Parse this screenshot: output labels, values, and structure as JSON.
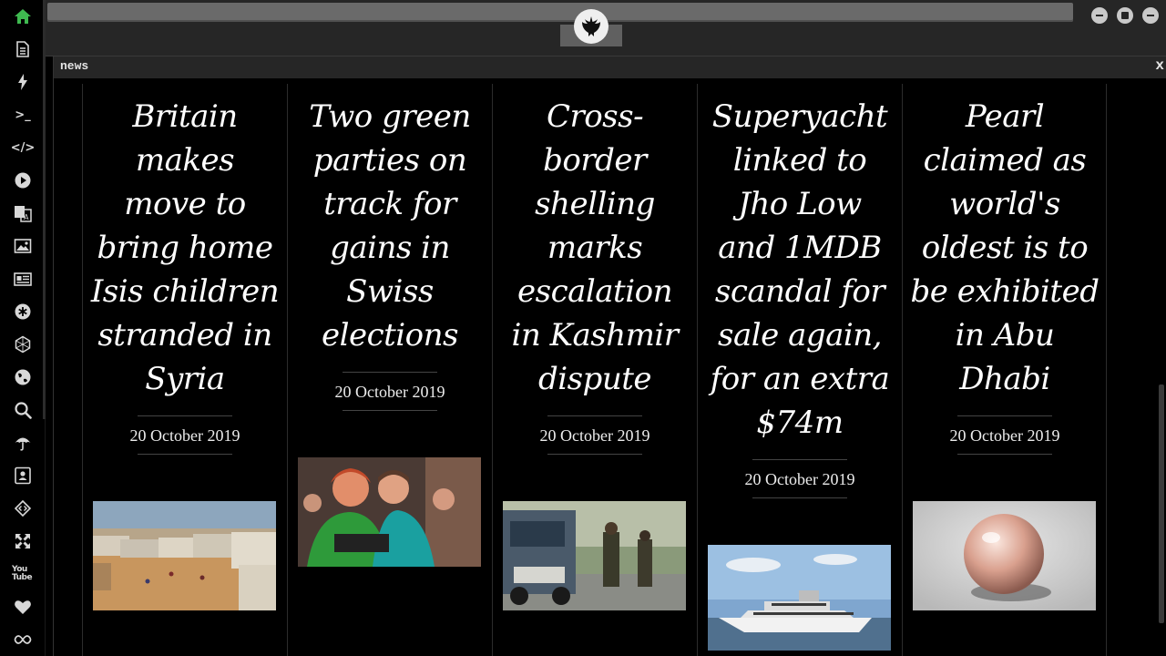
{
  "window": {
    "panel_title": "news",
    "close_label": "x"
  },
  "sidebar": {
    "items": [
      {
        "name": "home-icon",
        "active": true
      },
      {
        "name": "document-icon"
      },
      {
        "name": "bolt-icon"
      },
      {
        "name": "terminal-icon",
        "glyph": ">_"
      },
      {
        "name": "code-icon",
        "glyph": "</>"
      },
      {
        "name": "play-icon"
      },
      {
        "name": "translate-icon"
      },
      {
        "name": "image-icon"
      },
      {
        "name": "newspaper-icon"
      },
      {
        "name": "asterisk-icon"
      },
      {
        "name": "hexagon-icon"
      },
      {
        "name": "globe-icon"
      },
      {
        "name": "search-icon"
      },
      {
        "name": "umbrella-icon"
      },
      {
        "name": "contact-card-icon"
      },
      {
        "name": "diamond-code-icon"
      },
      {
        "name": "expand-icon"
      },
      {
        "name": "youtube-icon",
        "glyph": "You Tube"
      },
      {
        "name": "heart-icon"
      },
      {
        "name": "infinity-icon"
      }
    ]
  },
  "colors": {
    "accent_active": "#3fb950",
    "icon": "#d8d8d8",
    "background": "#000000"
  },
  "articles": [
    {
      "title": "Britain makes move to bring home Isis children stranded in Syria",
      "date": "20 October 2019",
      "image": "refugee-camp-photo"
    },
    {
      "title": "Two green parties on track for gains in Swiss elections",
      "date": "20 October 2019",
      "image": "green-party-supporters-photo"
    },
    {
      "title": "Cross-border shelling marks escalation in Kashmir dispute",
      "date": "20 October 2019",
      "image": "kashmir-soldiers-photo"
    },
    {
      "title": "Superyacht linked to Jho Low and 1MDB scandal for sale again, for an extra $74m",
      "date": "20 October 2019",
      "image": "superyacht-photo"
    },
    {
      "title": "Pearl claimed as world's oldest is to be exhibited in Abu Dhabi",
      "date": "20 October 2019",
      "image": "pearl-photo"
    }
  ]
}
